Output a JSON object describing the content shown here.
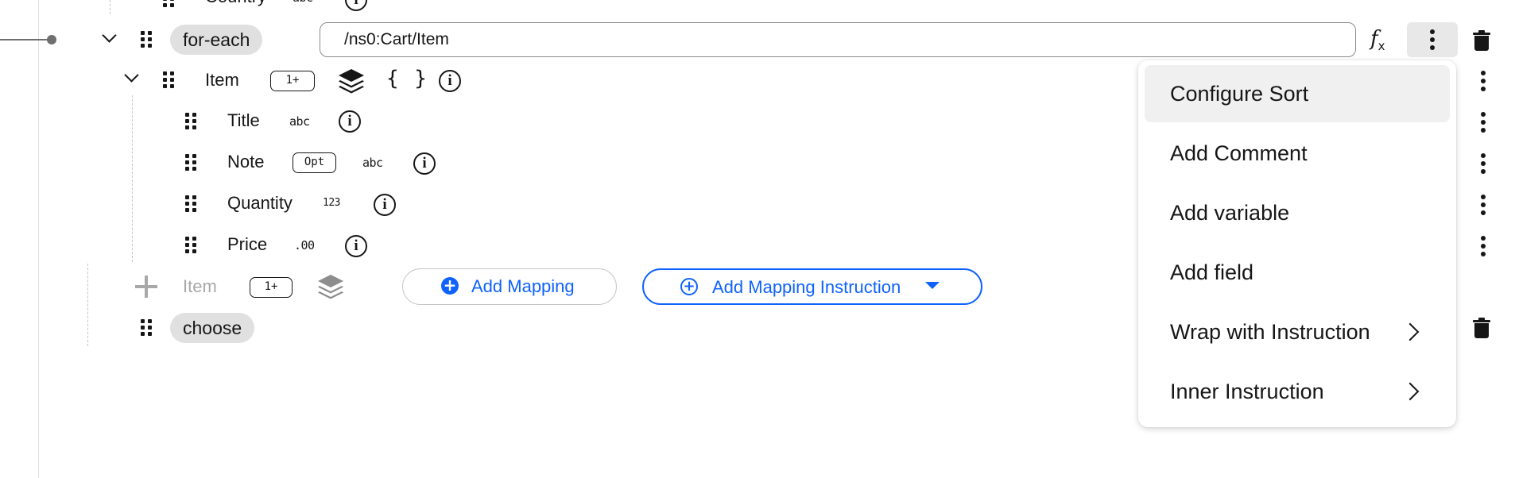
{
  "tree": {
    "country_row": {
      "label": "Country",
      "type": "abc"
    },
    "foreach": {
      "label": "for-each",
      "xpath_value": "/ns0:Cart/Item",
      "fx_label": "f",
      "fx_sub": "x"
    },
    "item": {
      "label": "Item",
      "cardinality": "1+",
      "braces": "{ }"
    },
    "fields": [
      {
        "label": "Title",
        "optional": "",
        "type": "abc"
      },
      {
        "label": "Note",
        "optional": "Opt",
        "type": "abc"
      },
      {
        "label": "Quantity",
        "optional": "",
        "type": "123"
      },
      {
        "label": "Price",
        "optional": "",
        "type": ".00"
      }
    ],
    "add_row": {
      "label": "Item",
      "cardinality": "1+",
      "add_mapping": "Add Mapping",
      "add_mapping_instruction": "Add Mapping Instruction"
    },
    "choose": {
      "label": "choose"
    }
  },
  "menu": {
    "items": [
      {
        "label": "Configure Sort",
        "submenu": false
      },
      {
        "label": "Add Comment",
        "submenu": false
      },
      {
        "label": "Add variable",
        "submenu": false
      },
      {
        "label": "Add field",
        "submenu": false
      },
      {
        "label": "Wrap with Instruction",
        "submenu": true
      },
      {
        "label": "Inner Instruction",
        "submenu": true
      }
    ]
  },
  "colors": {
    "accent": "#0f62fe",
    "pill_bg": "#e0e0e0",
    "menu_active": "#f0f0f0"
  }
}
